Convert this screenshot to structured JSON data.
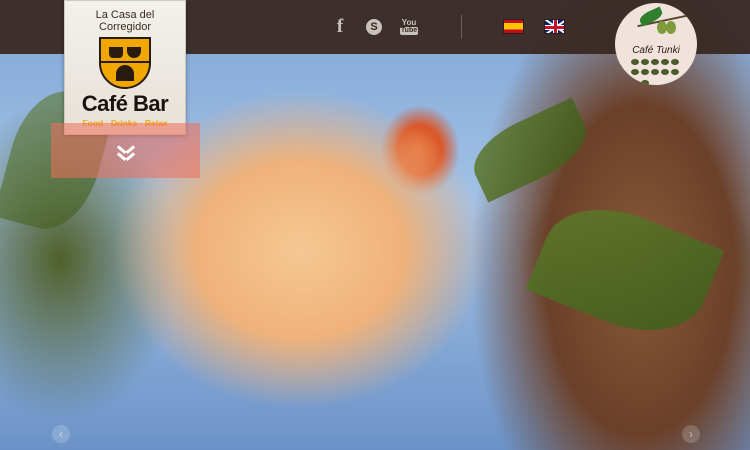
{
  "header": {
    "social": {
      "facebook_glyph": "f",
      "skype_glyph": "S",
      "youtube_you": "You",
      "youtube_tube": "Tube"
    },
    "languages": [
      "es",
      "en"
    ]
  },
  "logo": {
    "line1": "La Casa del",
    "line2": "Corregidor",
    "title": "Café Bar",
    "tag_food": "Food",
    "tag_drinks": "Drinks",
    "tag_relax": "Relax",
    "sep": " · "
  },
  "hero": {
    "scroll_indicator": "chevron-double-down-icon",
    "prev_glyph": "‹",
    "next_glyph": "›"
  },
  "partner": {
    "name": "Café Tunki"
  }
}
